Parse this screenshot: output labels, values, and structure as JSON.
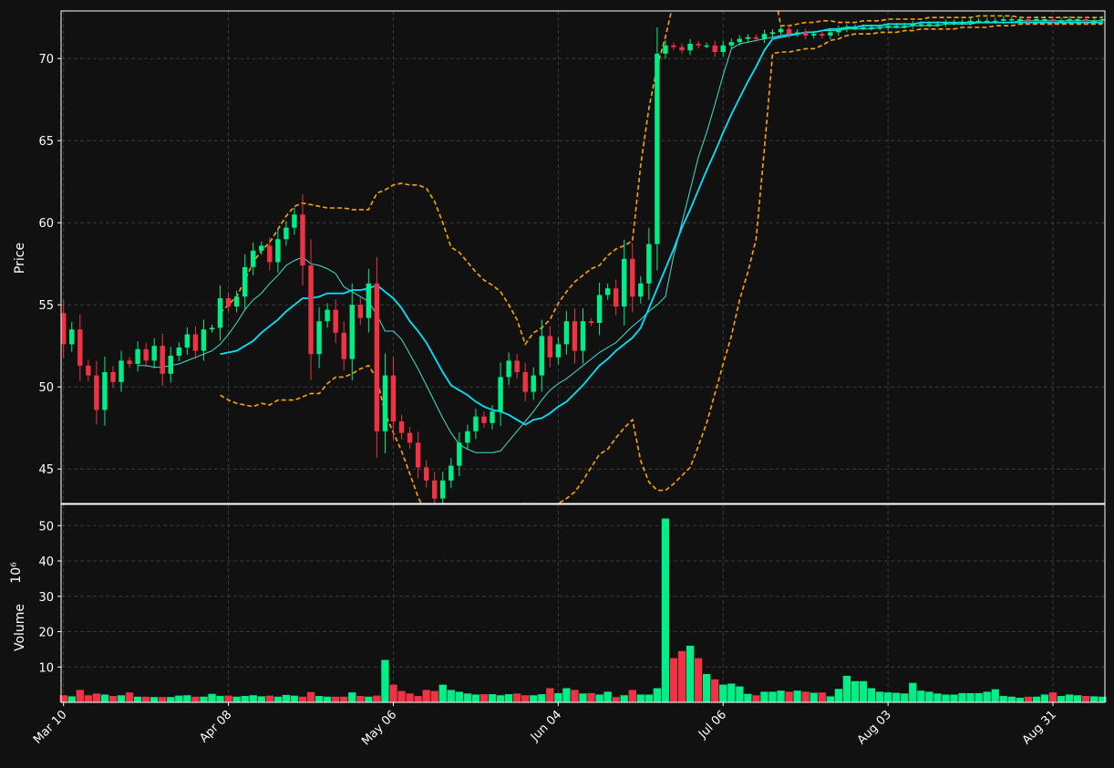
{
  "colors": {
    "background": "#111111",
    "frame": "#ffffff",
    "grid": "#3a3a3a",
    "up": "#00ee88",
    "down": "#ee3344",
    "sma_short": "#40e0d0",
    "sma_long": "#00e5ff",
    "bands": "#ffa500"
  },
  "chart_data": [
    {
      "type": "candlestick",
      "ylabel": "Price",
      "ylim": [
        42.9,
        72.9
      ],
      "yticks": [
        45,
        50,
        55,
        60,
        65,
        70
      ],
      "xlim": [
        -0.3,
        126.3
      ],
      "xticks": [
        {
          "index": 0,
          "label": "Mar 10"
        },
        {
          "index": 20,
          "label": "Apr 08"
        },
        {
          "index": 40,
          "label": "May 06"
        },
        {
          "index": 60,
          "label": "Jun 04"
        },
        {
          "index": 80,
          "label": "Jul 06"
        },
        {
          "index": 100,
          "label": "Aug 03"
        },
        {
          "index": 120,
          "label": "Aug 31"
        }
      ],
      "grid": true,
      "close": [
        52.6,
        53.5,
        51.3,
        50.7,
        48.6,
        50.9,
        50.3,
        51.6,
        51.4,
        52.3,
        51.6,
        52.5,
        50.8,
        51.9,
        52.4,
        53.2,
        52.2,
        53.5,
        53.6,
        55.4,
        54.9,
        55.5,
        57.3,
        58.3,
        58.6,
        57.6,
        59.0,
        59.7,
        60.5,
        57.4,
        52.0,
        54.0,
        54.7,
        53.3,
        51.7,
        55.0,
        54.2,
        56.3,
        47.3,
        50.7,
        47.9,
        47.2,
        46.6,
        45.1,
        44.3,
        43.2,
        44.3,
        45.2,
        46.6,
        47.3,
        48.2,
        47.8,
        48.5,
        50.6,
        51.6,
        50.9,
        49.7,
        50.7,
        53.1,
        51.8,
        52.6,
        54.0,
        52.2,
        54.0,
        53.9,
        55.6,
        56.0,
        54.9,
        57.8,
        55.5,
        56.3,
        58.7,
        70.3,
        70.8,
        70.7,
        70.5,
        70.9,
        70.8,
        70.8,
        70.4,
        70.8,
        71.0,
        71.2,
        71.3,
        71.2,
        71.5,
        71.6,
        71.8,
        71.5,
        71.6,
        71.4,
        71.5,
        71.4,
        71.6,
        71.8,
        71.9,
        71.9,
        71.9,
        71.9,
        71.9,
        72.0,
        72.0,
        72.0,
        72.1,
        72.1,
        72.1,
        72.1,
        72.2,
        72.2,
        72.2,
        72.3,
        72.3,
        72.3,
        72.3,
        72.4,
        72.4,
        72.4,
        72.3,
        72.4,
        72.4,
        72.3,
        72.3,
        72.4,
        72.4,
        72.3,
        72.3,
        72.4
      ],
      "sma_short": [
        null,
        null,
        null,
        null,
        null,
        null,
        null,
        null,
        null,
        51.3,
        51.3,
        51.2,
        51.2,
        51.3,
        51.4,
        51.6,
        51.8,
        52.0,
        52.2,
        52.6,
        53.2,
        53.9,
        54.7,
        55.3,
        55.7,
        56.3,
        56.8,
        57.4,
        57.7,
        57.9,
        57.5,
        57.4,
        57.2,
        56.9,
        56.1,
        55.8,
        55.5,
        55.2,
        54.4,
        53.4,
        53.4,
        52.9,
        52.0,
        51.1,
        50.1,
        49.1,
        48.1,
        47.2,
        46.5,
        46.2,
        46.0,
        46.0,
        46.0,
        46.1,
        46.7,
        47.3,
        47.9,
        48.5,
        49.2,
        49.8,
        50.2,
        50.5,
        50.9,
        51.3,
        51.7,
        52.1,
        52.4,
        52.7,
        53.2,
        53.7,
        54.1,
        54.6,
        55.0,
        55.5,
        58.0,
        60.0,
        62.0,
        64.0,
        65.5,
        67.2,
        69.0,
        70.6,
        70.9,
        71.0,
        71.1,
        71.2,
        71.3,
        71.4,
        71.5,
        71.5,
        71.6,
        71.6,
        71.7,
        71.7,
        71.7,
        71.8,
        71.8,
        71.8,
        71.8,
        71.9,
        71.9,
        71.9,
        71.9,
        72.0,
        72.0,
        72.0,
        72.0,
        72.1,
        72.1,
        72.1,
        72.1,
        72.2,
        72.2,
        72.2,
        72.2,
        72.2,
        72.3,
        72.3,
        72.3,
        72.3,
        72.3,
        72.3,
        72.3,
        72.3,
        72.3,
        72.3,
        72.3
      ],
      "sma_long": [
        null,
        null,
        null,
        null,
        null,
        null,
        null,
        null,
        null,
        null,
        null,
        null,
        null,
        null,
        null,
        null,
        null,
        null,
        null,
        52.0,
        52.1,
        52.2,
        52.5,
        52.8,
        53.3,
        53.7,
        54.1,
        54.6,
        55.0,
        55.4,
        55.4,
        55.5,
        55.7,
        55.7,
        55.7,
        55.9,
        55.9,
        56.0,
        56.2,
        55.8,
        55.4,
        54.8,
        54.0,
        53.4,
        52.7,
        51.8,
        50.9,
        50.1,
        49.8,
        49.5,
        49.1,
        48.8,
        48.6,
        48.5,
        48.3,
        48.0,
        47.7,
        48.0,
        48.1,
        48.4,
        48.8,
        49.1,
        49.6,
        50.1,
        50.7,
        51.3,
        51.7,
        52.2,
        52.6,
        53.0,
        53.6,
        54.8,
        56.0,
        57.2,
        58.4,
        59.7,
        60.8,
        62.0,
        63.2,
        64.3,
        65.5,
        66.6,
        67.6,
        68.6,
        69.5,
        70.5,
        71.2,
        71.3,
        71.4,
        71.5,
        71.6,
        71.6,
        71.7,
        71.8,
        71.8,
        71.9,
        71.9,
        72.0,
        72.0,
        72.0,
        72.1,
        72.1,
        72.1,
        72.1,
        72.2,
        72.2,
        72.2,
        72.2,
        72.2,
        72.2,
        72.2,
        72.2,
        72.2,
        72.2,
        72.2,
        72.2,
        72.2,
        72.2,
        72.2,
        72.2,
        72.2,
        72.2,
        72.2,
        72.2,
        72.2,
        72.2,
        72.2
      ],
      "upper_band": [
        null,
        null,
        null,
        null,
        null,
        null,
        null,
        null,
        null,
        null,
        null,
        null,
        null,
        null,
        null,
        null,
        null,
        null,
        null,
        54.5,
        55.0,
        55.5,
        56.5,
        57.6,
        58.3,
        58.8,
        59.6,
        60.4,
        61.0,
        61.2,
        61.1,
        61.0,
        60.9,
        60.9,
        60.9,
        60.8,
        60.8,
        60.8,
        61.8,
        62.0,
        62.3,
        62.4,
        62.3,
        62.3,
        62.1,
        61.3,
        60.0,
        58.5,
        58.2,
        57.6,
        57.0,
        56.5,
        56.2,
        55.8,
        55.0,
        54.1,
        52.6,
        53.3,
        53.6,
        54.1,
        55.1,
        55.8,
        56.4,
        56.8,
        57.2,
        57.4,
        58.0,
        58.4,
        58.6,
        58.9,
        63.5,
        67.0,
        69.5,
        71.3,
        73.5,
        75.0,
        76.3,
        77.5,
        78.2,
        78.6,
        78.6,
        78.4,
        78.1,
        77.6,
        76.5,
        75.5,
        74.5,
        72.0,
        72.0,
        72.1,
        72.2,
        72.2,
        72.3,
        72.3,
        72.2,
        72.2,
        72.2,
        72.3,
        72.3,
        72.3,
        72.4,
        72.4,
        72.4,
        72.4,
        72.4,
        72.5,
        72.5,
        72.5,
        72.5,
        72.5,
        72.5,
        72.6,
        72.6,
        72.6,
        72.6,
        72.6,
        72.5,
        72.5,
        72.5,
        72.5,
        72.5,
        72.5,
        72.5,
        72.5,
        72.5,
        72.5,
        72.5
      ],
      "lower_band": [
        null,
        null,
        null,
        null,
        null,
        null,
        null,
        null,
        null,
        null,
        null,
        null,
        null,
        null,
        null,
        null,
        null,
        null,
        null,
        49.5,
        49.2,
        49.0,
        48.9,
        48.8,
        49.0,
        48.9,
        49.2,
        49.2,
        49.2,
        49.4,
        49.6,
        49.6,
        50.2,
        50.6,
        50.6,
        50.8,
        51.1,
        51.3,
        50.5,
        48.4,
        47.2,
        46.1,
        44.7,
        43.3,
        42.2,
        41.3,
        40.5,
        39.8,
        39.7,
        39.8,
        40.0,
        40.4,
        41.0,
        41.8,
        42.4,
        42.8,
        42.9,
        42.7,
        42.6,
        42.7,
        42.9,
        43.2,
        43.6,
        44.3,
        45.1,
        45.9,
        46.2,
        46.9,
        47.5,
        48.0,
        45.5,
        44.2,
        43.7,
        43.7,
        44.1,
        44.6,
        45.1,
        46.4,
        47.8,
        49.6,
        51.4,
        53.1,
        55.3,
        57.0,
        59.0,
        64.5,
        70.3,
        70.4,
        70.4,
        70.5,
        70.6,
        70.6,
        70.8,
        71.1,
        71.2,
        71.4,
        71.5,
        71.5,
        71.5,
        71.6,
        71.6,
        71.6,
        71.7,
        71.7,
        71.8,
        71.8,
        71.8,
        71.8,
        71.8,
        71.9,
        71.9,
        71.9,
        71.9,
        72.0,
        72.0,
        72.0,
        72.1,
        72.1,
        72.1,
        72.1,
        72.1,
        72.1,
        72.1,
        72.1,
        72.1,
        72.1,
        72.1
      ]
    },
    {
      "type": "bar",
      "ylabel": "Volume",
      "yscale_label": "10⁶",
      "ylim": [
        0,
        56
      ],
      "yticks": [
        10,
        20,
        30,
        40,
        50
      ],
      "values": [
        2,
        1.7,
        3.5,
        2,
        2.5,
        2.2,
        1.8,
        2,
        2.8,
        1.6,
        1.6,
        1.5,
        1.5,
        1.5,
        1.9,
        2,
        1.6,
        1.6,
        2.4,
        1.8,
        1.9,
        1.6,
        1.8,
        2,
        1.7,
        1.9,
        1.6,
        2.1,
        1.9,
        1.6,
        2.9,
        1.8,
        1.6,
        1.6,
        1.6,
        2.8,
        1.8,
        1.6,
        1.9,
        12,
        5,
        3.2,
        2.5,
        1.8,
        3.5,
        3.2,
        5,
        3.5,
        3,
        2.5,
        2.2,
        2.3,
        2.3,
        2,
        2.3,
        2.5,
        2,
        2,
        2.3,
        4,
        2.6,
        4,
        3.5,
        2.5,
        2.6,
        2.2,
        3,
        1.5,
        2,
        3.5,
        2.2,
        2.2,
        4,
        52,
        12.5,
        14.5,
        16,
        12.5,
        8,
        6.5,
        5,
        5.3,
        4.5,
        2.4,
        2,
        3,
        3,
        3.3,
        3,
        3.3,
        3,
        2.7,
        2.8,
        1.7,
        3.8,
        7.5,
        6,
        6,
        4,
        3,
        2.8,
        2.7,
        2.5,
        5.5,
        3.3,
        3,
        2.5,
        2.2,
        2.2,
        2.6,
        2.6,
        2.6,
        3,
        3.7,
        1.8,
        1.6,
        1.3,
        1.6,
        1.6,
        2.2,
        2.8,
        1.8,
        2.2,
        2,
        1.8,
        1.7,
        1.6
      ]
    }
  ]
}
